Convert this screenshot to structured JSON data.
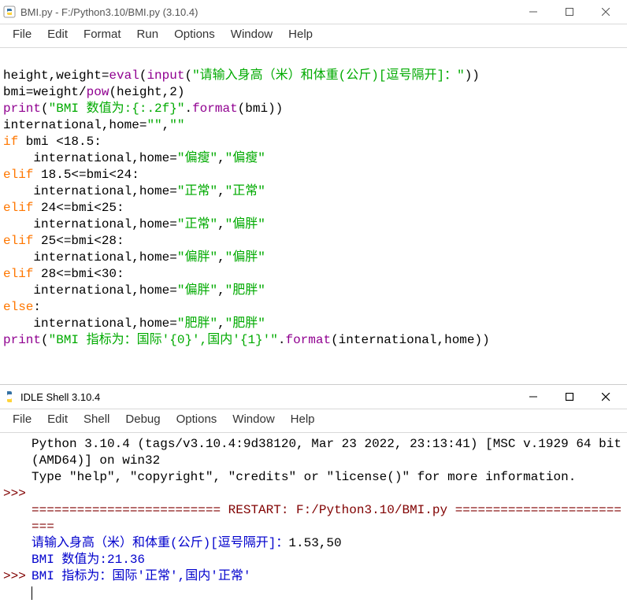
{
  "window1": {
    "title": "BMI.py - F:/Python3.10/BMI.py (3.10.4)",
    "menu": [
      "File",
      "Edit",
      "Format",
      "Run",
      "Options",
      "Window",
      "Help"
    ]
  },
  "code": {
    "l1a": "height,weight=",
    "l1b": "eval",
    "l1c": "(",
    "l1d": "input",
    "l1e": "(",
    "l1f": "\"请输入身高（米）和体重(公斤)[逗号隔开]：\"",
    "l1g": "))",
    "l2a": "bmi=weight/",
    "l2b": "pow",
    "l2c": "(height,2)",
    "l3a": "print",
    "l3b": "(",
    "l3c": "\"BMI 数值为:{:.2f}\"",
    "l3d": ".",
    "l3e": "format",
    "l3f": "(bmi))",
    "l4a": "international,home=",
    "l4b": "\"\"",
    "l4c": ",",
    "l4d": "\"\"",
    "l5a": "if",
    "l5b": " bmi <18.5:",
    "l6a": "    international,home=",
    "l6b": "\"偏瘦\"",
    "l6c": ",",
    "l6d": "\"偏瘦\"",
    "l7a": "elif",
    "l7b": " 18.5<=bmi<24:",
    "l8a": "    international,home=",
    "l8b": "\"正常\"",
    "l8c": ",",
    "l8d": "\"正常\"",
    "l9a": "elif",
    "l9b": " 24<=bmi<25:",
    "l10a": "    international,home=",
    "l10b": "\"正常\"",
    "l10c": ",",
    "l10d": "\"偏胖\"",
    "l11a": "elif",
    "l11b": " 25<=bmi<28:",
    "l12a": "    international,home=",
    "l12b": "\"偏胖\"",
    "l12c": ",",
    "l12d": "\"偏胖\"",
    "l13a": "elif",
    "l13b": " 28<=bmi<30:",
    "l14a": "    international,home=",
    "l14b": "\"偏胖\"",
    "l14c": ",",
    "l14d": "\"肥胖\"",
    "l15a": "else",
    "l15b": ":",
    "l16a": "    international,home=",
    "l16b": "\"肥胖\"",
    "l16c": ",",
    "l16d": "\"肥胖\"",
    "l17a": "print",
    "l17b": "(",
    "l17c": "\"BMI 指标为：国际'{0}',国内'{1}'\"",
    "l17d": ".",
    "l17e": "format",
    "l17f": "(international,home))"
  },
  "window2": {
    "title": "IDLE Shell 3.10.4",
    "menu": [
      "File",
      "Edit",
      "Shell",
      "Debug",
      "Options",
      "Window",
      "Help"
    ]
  },
  "shell": {
    "banner1": "Python 3.10.4 (tags/v3.10.4:9d38120, Mar 23 2022, 23:13:41) [MSC v.1929 64 bit (AMD64)] on win32",
    "banner2": "Type \"help\", \"copyright\", \"credits\" or \"license()\" for more information.",
    "restart": "========================= RESTART: F:/Python3.10/BMI.py =========================",
    "inprompt": "请输入身高（米）和体重(公斤)[逗号隔开]：",
    "inval": "1.53,50",
    "out1": "BMI 数值为:21.36",
    "out2": "BMI 指标为：国际'正常',国内'正常'",
    "prompt": ">>>"
  }
}
